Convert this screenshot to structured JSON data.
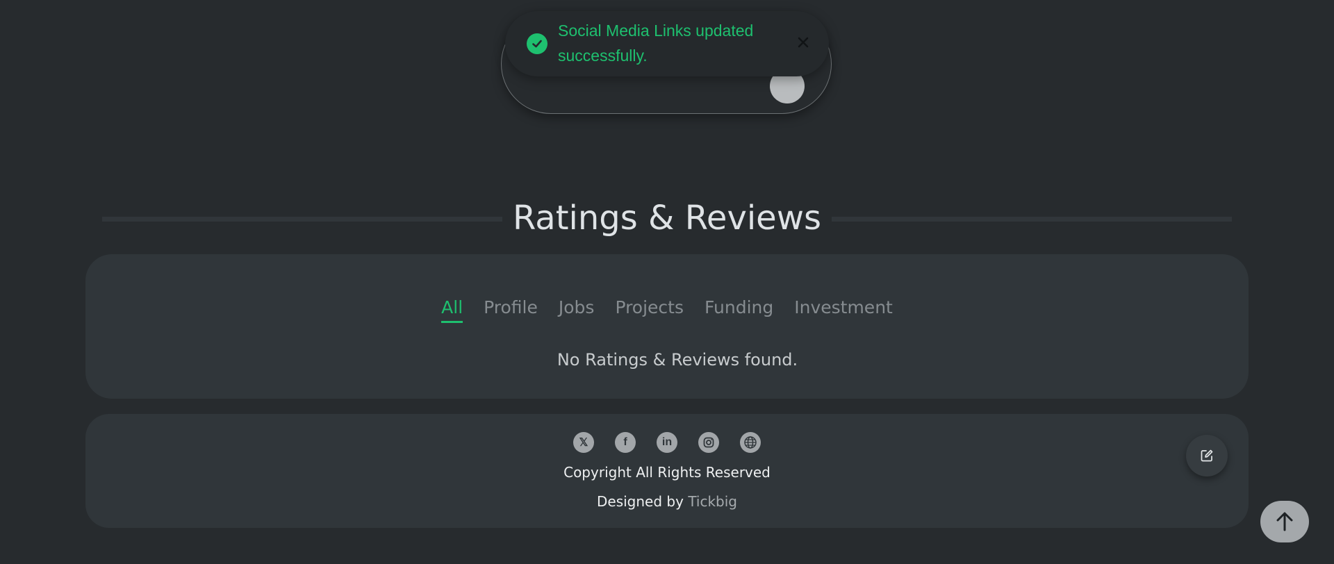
{
  "toast": {
    "message": "Social Media Links updated successfully.",
    "icon": "check-circle-icon",
    "close_icon": "close-icon",
    "color": "#1ec06f"
  },
  "ratings": {
    "title": "Ratings & Reviews",
    "tabs": [
      {
        "label": "All",
        "active": true
      },
      {
        "label": "Profile",
        "active": false
      },
      {
        "label": "Jobs",
        "active": false
      },
      {
        "label": "Projects",
        "active": false
      },
      {
        "label": "Funding",
        "active": false
      },
      {
        "label": "Investment",
        "active": false
      }
    ],
    "empty_message": "No Ratings & Reviews found."
  },
  "footer": {
    "social_links": [
      {
        "name": "x-icon",
        "glyph": "𝕏"
      },
      {
        "name": "facebook-icon",
        "glyph": "f"
      },
      {
        "name": "linkedin-icon",
        "glyph": "in"
      },
      {
        "name": "instagram-icon",
        "glyph": ""
      },
      {
        "name": "globe-icon",
        "glyph": ""
      }
    ],
    "copyright": "Copyright All Rights Reserved",
    "designed_by_prefix": "Designed by",
    "designed_by_brand": "Tickbig",
    "edit_icon": "edit-icon"
  },
  "scroll_top": {
    "icon": "arrow-up-icon"
  }
}
